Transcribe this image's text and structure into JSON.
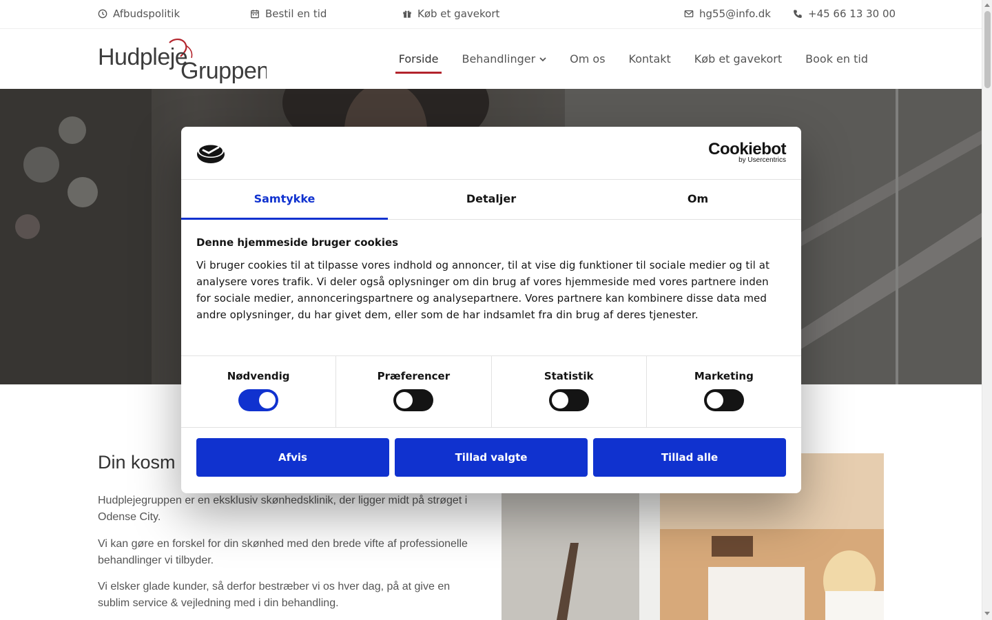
{
  "topbar": {
    "cancel_policy": "Afbudspolitik",
    "book_time": "Bestil en tid",
    "gift_card": "Køb et gavekort",
    "email": "hg55@info.dk",
    "phone": "+45 66 13 30 00"
  },
  "logo": {
    "part1": "Hudpleje",
    "part2": "Gruppen"
  },
  "nav": {
    "items": [
      {
        "label": "Forside",
        "active": true
      },
      {
        "label": "Behandlinger",
        "dropdown": true
      },
      {
        "label": "Om os"
      },
      {
        "label": "Kontakt"
      },
      {
        "label": "Køb et gavekort"
      },
      {
        "label": "Book en tid"
      }
    ]
  },
  "content": {
    "title": "Din kosm",
    "paragraphs": [
      "Hudplejegruppen er en eksklusiv skønhedsklinik, der ligger midt på strøget i Odense City.",
      "Vi kan gøre en forskel for din skønhed med den brede vifte af professionelle behandlinger vi tilbyder.",
      "Vi elsker glade kunder, så derfor bestræber vi os hver dag, på at give en sublim service & vejledning med i din behandling."
    ]
  },
  "cookie_dialog": {
    "brand": "Cookiebot",
    "brand_sub": "by Usercentrics",
    "tabs": [
      {
        "label": "Samtykke",
        "active": true
      },
      {
        "label": "Detaljer"
      },
      {
        "label": "Om"
      }
    ],
    "heading": "Denne hjemmeside bruger cookies",
    "text": "Vi bruger cookies til at tilpasse vores indhold og annoncer, til at vise dig funktioner til sociale medier og til at analysere vores trafik. Vi deler også oplysninger om din brug af vores hjemmeside med vores partnere inden for sociale medier, annonceringspartnere og analysepartnere. Vores partnere kan kombinere disse data med andre oplysninger, du har givet dem, eller som de har indsamlet fra din brug af deres tjenester.",
    "toggles": [
      {
        "label": "Nødvendig",
        "on": true
      },
      {
        "label": "Præferencer",
        "on": false
      },
      {
        "label": "Statistik",
        "on": false
      },
      {
        "label": "Marketing",
        "on": false
      }
    ],
    "buttons": {
      "reject": "Afvis",
      "allow_selected": "Tillad valgte",
      "allow_all": "Tillad alle"
    },
    "accent_color": "#1032cf"
  },
  "brand_color": "#b3242c"
}
